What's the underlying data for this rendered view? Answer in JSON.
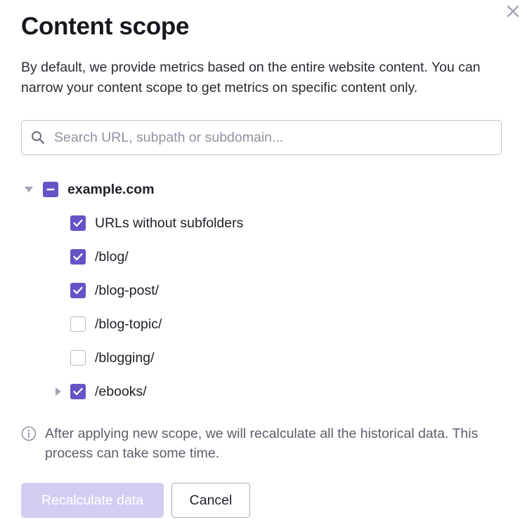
{
  "dialog": {
    "title": "Content scope",
    "description": "By default, we provide metrics based on the entire website content. You can narrow your content scope to get metrics on specific content only.",
    "close_icon": "close-icon"
  },
  "search": {
    "placeholder": "Search URL, subpath or subdomain...",
    "value": "",
    "icon": "search-icon"
  },
  "tree": {
    "root": {
      "label": "example.com",
      "state": "indeterminate",
      "expanded": true
    },
    "items": [
      {
        "label": "URLs without subfolders",
        "checked": true,
        "has_children": false
      },
      {
        "label": "/blog/",
        "checked": true,
        "has_children": false
      },
      {
        "label": "/blog-post/",
        "checked": true,
        "has_children": false
      },
      {
        "label": "/blog-topic/",
        "checked": false,
        "has_children": false
      },
      {
        "label": "/blogging/",
        "checked": false,
        "has_children": false
      },
      {
        "label": "/ebooks/",
        "checked": true,
        "has_children": true
      }
    ]
  },
  "notice": {
    "icon": "info-icon",
    "text": "After applying new scope, we will recalculate all the historical data. This process can take some time."
  },
  "actions": {
    "recalculate_label": "Recalculate data",
    "recalculate_disabled": true,
    "cancel_label": "Cancel"
  },
  "colors": {
    "accent": "#6753c5",
    "accent_disabled": "#d4cdf2",
    "text": "#1f1f29",
    "muted": "#5b5e6e"
  }
}
